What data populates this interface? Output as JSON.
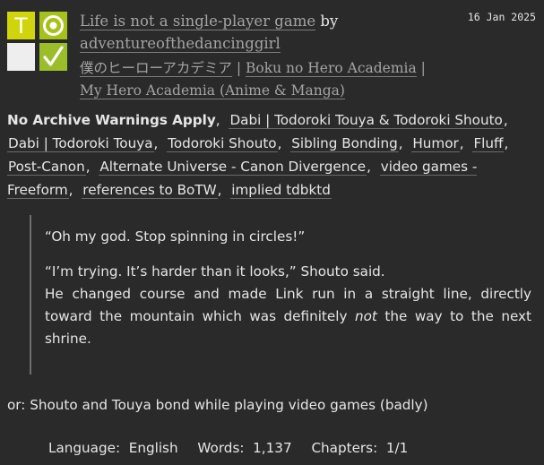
{
  "work": {
    "title": "Life is not a single-player game",
    "by_label": "by",
    "author": "adventureofthedancinggirl",
    "date": "16 Jan 2025",
    "required_tags": {
      "rating_letter": "T",
      "rating_color": "#d0d40a",
      "category_color": "#a6c21a",
      "warning_color": "#eeeeee",
      "status_color": "#9cbd2a",
      "icons": [
        "rating-teen-icon",
        "category-gen-icon",
        "no-warnings-icon",
        "complete-check-icon"
      ]
    },
    "fandoms": [
      "僕のヒーローアカデミア",
      "Boku no Hero Academia",
      "My Hero Academia (Anime & Manga)"
    ],
    "fandom_separator": "|",
    "warning_tag": "No Archive Warnings Apply",
    "tags": [
      "Dabi | Todoroki Touya & Todoroki Shouto",
      "Dabi | Todoroki Touya",
      "Todoroki Shouto",
      "Sibling Bonding",
      "Humor",
      "Fluff",
      "Post-Canon",
      "Alternate Universe - Canon Divergence",
      "video games - Freeform",
      "references to BoTW",
      "implied tdbktd"
    ],
    "summary": {
      "line1": "“Oh my god. Stop spinning in circles!”",
      "line2": "“I’m trying. It’s harder than it looks,” Shouto said.",
      "line3_before": "He changed course and made Link run in a straight line, directly toward the mountain which was definitely ",
      "line3_emph": "not",
      "line3_after": " the way to the next shrine."
    },
    "tagline": "or: Shouto and Touya bond while playing video games (badly)",
    "stats": {
      "language_label": "Language:",
      "language": "English",
      "words_label": "Words:",
      "words": "1,137",
      "chapters_label": "Chapters:",
      "chapters": "1/1"
    }
  }
}
